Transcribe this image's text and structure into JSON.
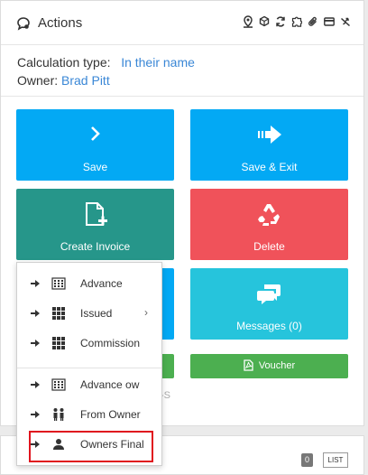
{
  "header": {
    "title": "Actions"
  },
  "info": {
    "calc_label": "Calculation type:",
    "calc_value": "In their name",
    "owner_label": "Owner:",
    "owner_value": "Brad Pitt"
  },
  "tiles": {
    "save": "Save",
    "save_exit": "Save & Exit",
    "create_invoice": "Create Invoice",
    "delete": "Delete",
    "messages": "Messages (0)",
    "voucher": "Voucher"
  },
  "faded_text": "-S",
  "menu": {
    "items": [
      {
        "label": "Advance",
        "icon": "calculator-icon"
      },
      {
        "label": "Issued",
        "icon": "grid-icon",
        "has_submenu": true
      },
      {
        "label": "Commission",
        "icon": "grid-icon"
      },
      {
        "label": "Advance ow",
        "icon": "calculator-icon"
      },
      {
        "label": "From Owner",
        "icon": "two-people-icon"
      },
      {
        "label": "Owners Final",
        "icon": "person-icon"
      }
    ]
  },
  "bottom": {
    "badge": "0",
    "list_label": "LIST"
  },
  "colors": {
    "blue": "#03a9f4",
    "teal": "#26968a",
    "red": "#f0525a",
    "cyan": "#26c4dc",
    "green": "#4caf50",
    "link": "#3a87d6",
    "highlight": "#e0141e"
  }
}
